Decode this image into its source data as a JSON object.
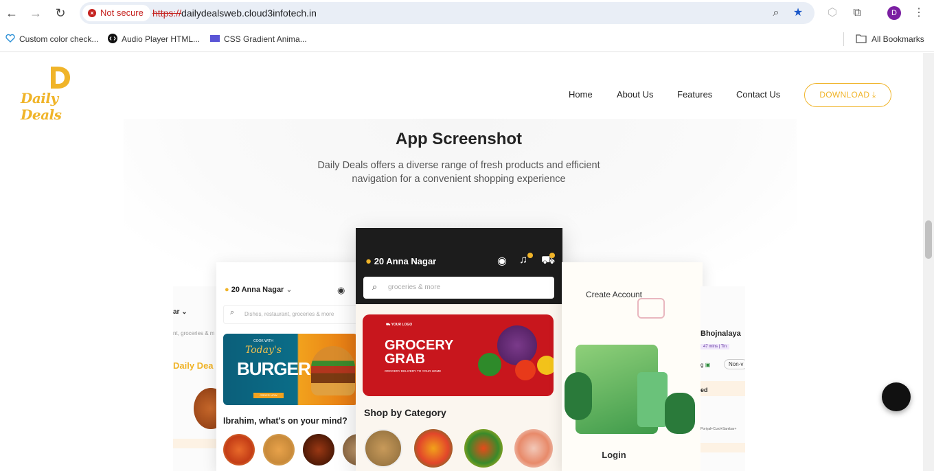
{
  "browser": {
    "security_label": "Not secure",
    "url_scheme": "https://",
    "url_host": "dailydealsweb.cloud3infotech.in",
    "profile_initial": "D",
    "bookmarks": [
      "Custom color check...",
      "Audio Player HTML...",
      "CSS Gradient Anima..."
    ],
    "all_bookmarks": "All Bookmarks"
  },
  "site": {
    "logo_text": "Daily Deals",
    "nav": [
      "Home",
      "About Us",
      "Features",
      "Contact Us"
    ],
    "download_label": "DOWNLOAD",
    "section_title": "App Screenshot",
    "section_sub_line1": "Daily Deals offers a diverse range of fresh products and efficient",
    "section_sub_line2": "navigation for a convenient shopping experience"
  },
  "mockups": {
    "left": {
      "location": "20 Anna Nagar",
      "search_placeholder": "Dishes, restaurant, groceries & more",
      "banner_small": "COOK WITH",
      "banner_script": "Today's",
      "banner_big": "BURGER",
      "banner_btn": "ORDER NOW",
      "prompt": "Ibrahim, what's on your mind?"
    },
    "left_far": {
      "label": "Daily Dea",
      "chip": "ar",
      "sub": "nt, groceries & m"
    },
    "center": {
      "location": "20 Anna Nagar",
      "search_placeholder": "groceries & more",
      "banner_logo": "YOUR LOGO",
      "banner_line1": "GROCERY",
      "banner_line2": "GRAB",
      "banner_tag": "GROCERY DELIVERY TO YOUR HOME",
      "shop_by": "Shop by Category"
    },
    "right": {
      "title": "Create Account",
      "login": "Login"
    },
    "right_far": {
      "name": "Bhojnalaya",
      "meta": "47 mins | Tin",
      "veg": "g",
      "nonveg": "Non-v",
      "ed": "ed",
      "items": "Poriyal+Curd+Sambar+"
    }
  },
  "colors": {
    "brand": "#f0b429",
    "dark": "#1c1c1c",
    "grocery_red": "#c8161d"
  }
}
